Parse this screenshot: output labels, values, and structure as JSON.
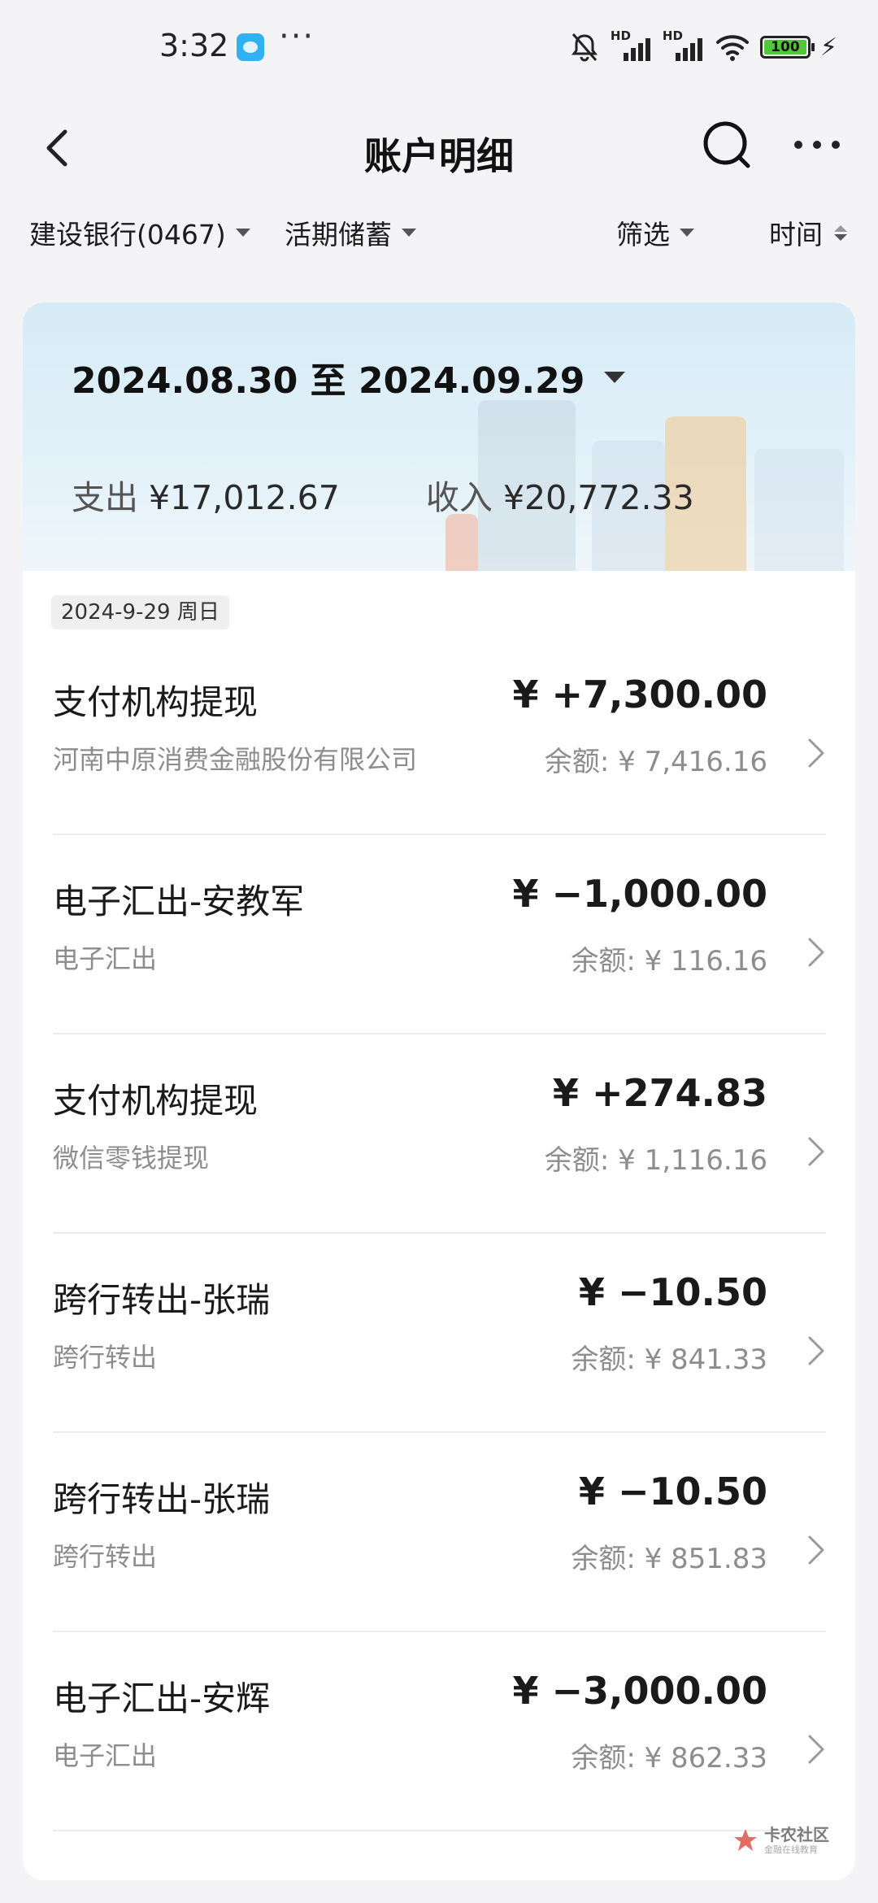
{
  "status_bar": {
    "time": "3:32",
    "dots": "···",
    "battery": "100",
    "hd1": "HD",
    "hd2": "HD"
  },
  "header": {
    "title": "账户明细"
  },
  "filters": {
    "account": "建设银行(0467)",
    "account_type": "活期储蓄",
    "filter": "筛选",
    "sort": "时间"
  },
  "period": {
    "range": "2024.08.30 至 2024.09.29",
    "expense_label": "支出",
    "expense": "¥17,012.67",
    "income_label": "收入",
    "income": "¥20,772.33"
  },
  "date_group": "2024-9-29 周日",
  "transactions": [
    {
      "title": "支付机构提现",
      "amount": "¥ +7,300.00",
      "sub": "河南中原消费金融股份有限公司",
      "balance": "余额: ¥ 7,416.16"
    },
    {
      "title": "电子汇出-安教军",
      "amount": "¥ −1,000.00",
      "sub": "电子汇出",
      "balance": "余额: ¥ 116.16"
    },
    {
      "title": "支付机构提现",
      "amount": "¥ +274.83",
      "sub": "微信零钱提现",
      "balance": "余额: ¥ 1,116.16"
    },
    {
      "title": "跨行转出-张瑞",
      "amount": "¥ −10.50",
      "sub": "跨行转出",
      "balance": "余额: ¥ 841.33"
    },
    {
      "title": "跨行转出-张瑞",
      "amount": "¥ −10.50",
      "sub": "跨行转出",
      "balance": "余额: ¥ 851.83"
    },
    {
      "title": "电子汇出-安辉",
      "amount": "¥ −3,000.00",
      "sub": "电子汇出",
      "balance": "余额: ¥ 862.33"
    }
  ],
  "watermark": {
    "main": "卡农社区",
    "small": "金融在线教育"
  }
}
